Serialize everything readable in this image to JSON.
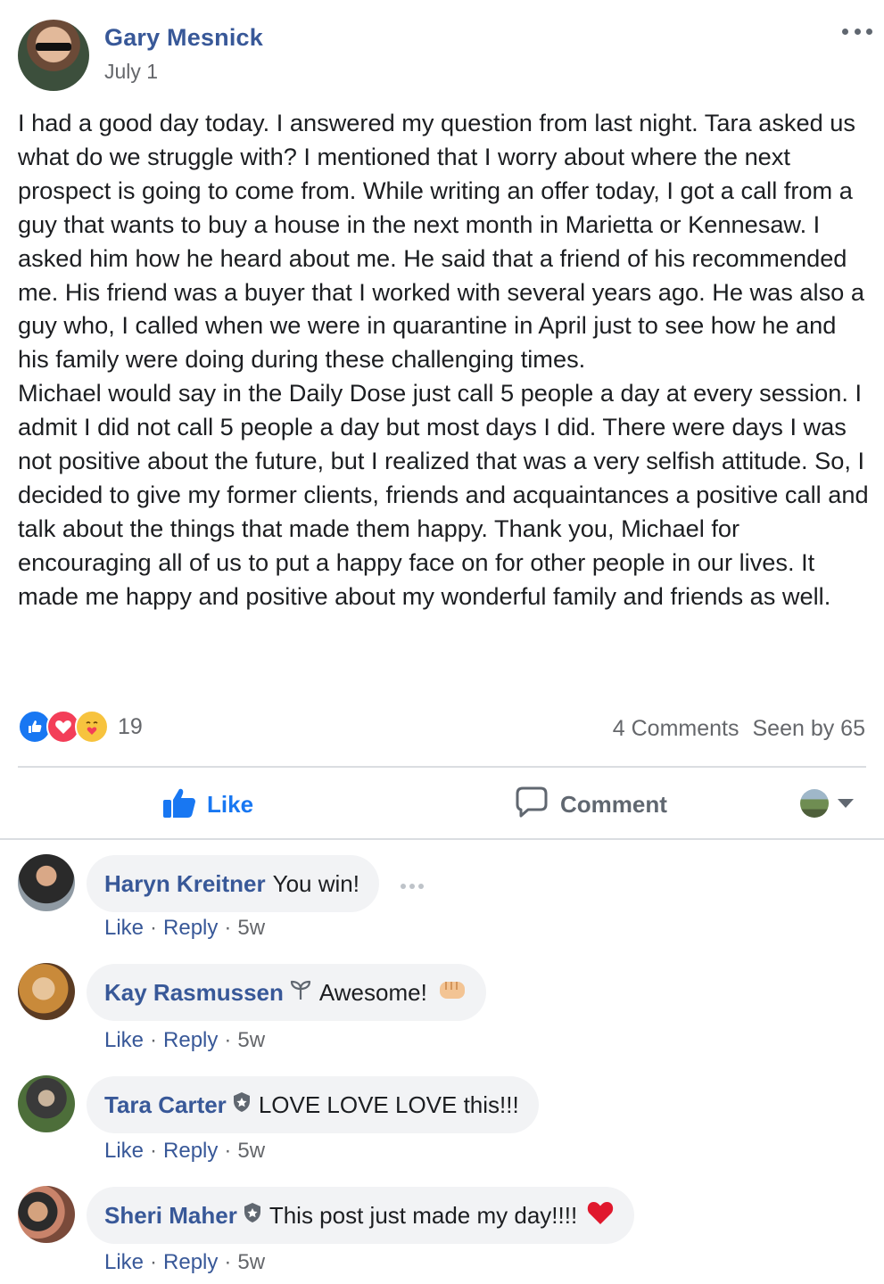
{
  "post": {
    "author": "Gary Mesnick",
    "date": "July 1",
    "text": "I had a good day today. I answered my question from last night. Tara asked us what do we struggle with? I mentioned that I worry about where the next prospect is going to come from. While writing an offer today, I got a call from a guy that wants to buy a house in the next month in Marietta or Kennesaw. I asked him how he heard about me. He said that a friend of his recommended me. His friend was a buyer that I worked with several years ago. He was also a guy who, I called when we were in quarantine in April just to see how he and his family were doing during these challenging times.\nMichael would say in the Daily Dose just call 5 people a day at every session. I admit I did not call 5 people a day but most days I did. There were days I was not positive about the future, but I realized that was a very selfish attitude. So, I decided to give my former clients, friends and acquaintances a positive call and talk about the things that made them happy. Thank you, Michael for encouraging all of us to put a happy face on for other people in our lives. It made me happy and positive about my wonderful family and friends as well.",
    "reaction_count": "19",
    "comments_count": "4 Comments",
    "seen_by": "Seen by 65"
  },
  "actions": {
    "like": "Like",
    "comment": "Comment"
  },
  "comments": [
    {
      "name": "Haryn Kreitner",
      "text": "You win!",
      "like": "Like",
      "reply": "Reply",
      "time": "5w"
    },
    {
      "name": "Kay Rasmussen",
      "text": "Awesome!",
      "like": "Like",
      "reply": "Reply",
      "time": "5w"
    },
    {
      "name": "Tara Carter",
      "text": "LOVE LOVE LOVE this!!!",
      "like": "Like",
      "reply": "Reply",
      "time": "5w"
    },
    {
      "name": "Sheri Maher",
      "text": "This post just made my day!!!!",
      "like": "Like",
      "reply": "Reply",
      "time": "5w"
    }
  ],
  "colors": {
    "link": "#385898",
    "like_blue": "#1877f2",
    "secondary_text": "#65676b",
    "bubble_bg": "#f2f3f5"
  },
  "icons": [
    "more-icon",
    "like-reaction-icon",
    "love-reaction-icon",
    "care-reaction-icon",
    "thumbs-up-icon",
    "comment-icon",
    "audience-avatar",
    "caret-down-icon",
    "plant-badge-icon",
    "shield-badge-icon",
    "fist-emoji",
    "heart-emoji"
  ]
}
